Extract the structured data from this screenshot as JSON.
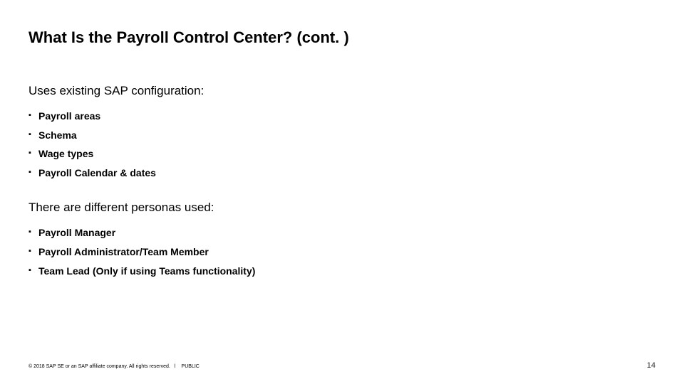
{
  "title": "What Is the Payroll Control Center? (cont. )",
  "sections": [
    {
      "heading": "Uses existing SAP configuration:",
      "bullets": [
        "Payroll areas",
        "Schema",
        "Wage types",
        "Payroll Calendar & dates"
      ]
    },
    {
      "heading": "There are different personas used:",
      "bullets": [
        "Payroll Manager",
        "Payroll Administrator/Team Member",
        "Team Lead (Only if using Teams functionality)"
      ]
    }
  ],
  "footer": {
    "copyright": "© 2018 SAP SE or an SAP affiliate company. All rights reserved.",
    "separator": "ǀ",
    "classification": "PUBLIC",
    "page": "14"
  }
}
